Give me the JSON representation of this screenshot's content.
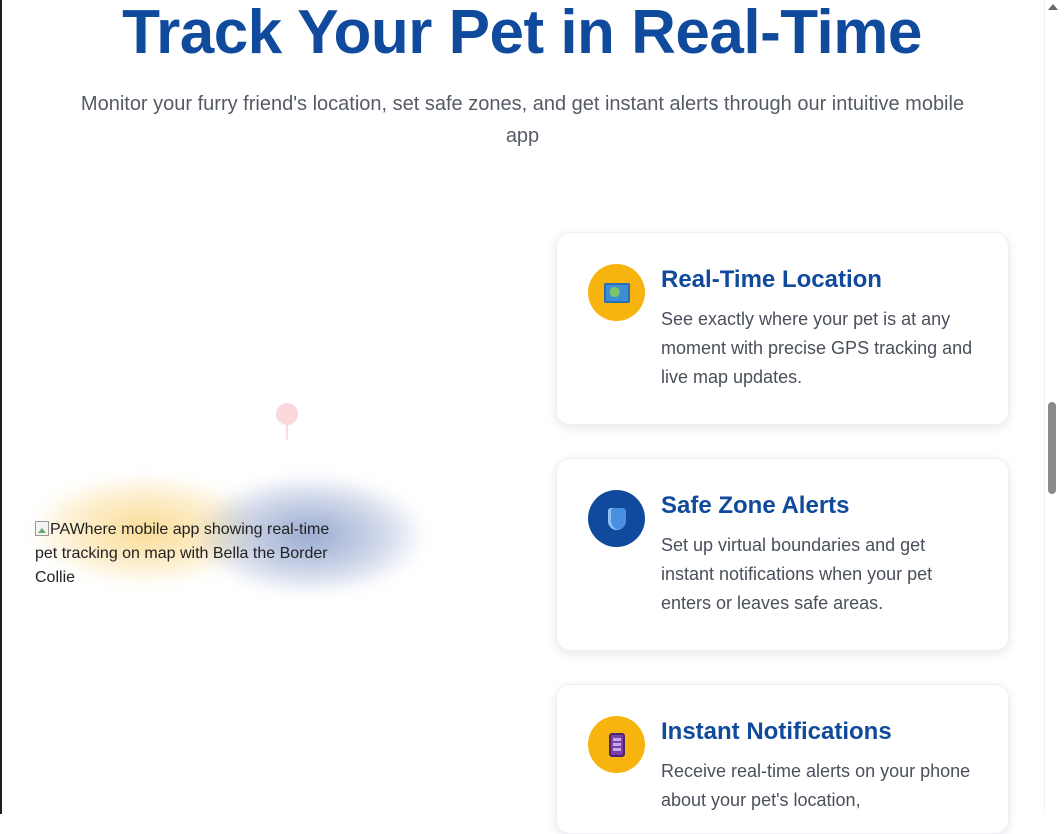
{
  "hero": {
    "title": "Track Your Pet in Real-Time",
    "subtitle": "Monitor your furry friend's location, set safe zones, and get instant alerts through our intuitive mobile app"
  },
  "app_preview": {
    "alt_text": "PAWhere mobile app showing real-time pet tracking on map with Bella the Border Collie"
  },
  "features": [
    {
      "icon": "map-icon",
      "title": "Real-Time Location",
      "text": "See exactly where your pet is at any moment with precise GPS tracking and live map updates."
    },
    {
      "icon": "shield-icon",
      "title": "Safe Zone Alerts",
      "text": "Set up virtual boundaries and get instant notifications when your pet enters or leaves safe areas."
    },
    {
      "icon": "mobile-phone-icon",
      "title": "Instant Notifications",
      "text": "Receive real-time alerts on your phone about your pet's location,"
    }
  ],
  "colors": {
    "brand_blue": "#0f4a9c",
    "accent_yellow": "#f8b40e",
    "body_text": "#4a505b"
  }
}
